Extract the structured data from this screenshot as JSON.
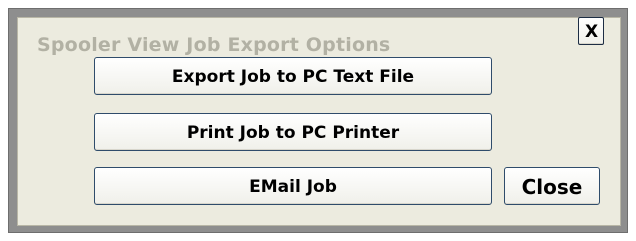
{
  "dialog": {
    "title": "Spooler View Job Export Options",
    "close_x_label": "X",
    "buttons": {
      "export_label": "Export Job to PC Text File",
      "print_label": "Print Job to PC Printer",
      "email_label": "EMail Job",
      "close_label": "Close"
    }
  }
}
